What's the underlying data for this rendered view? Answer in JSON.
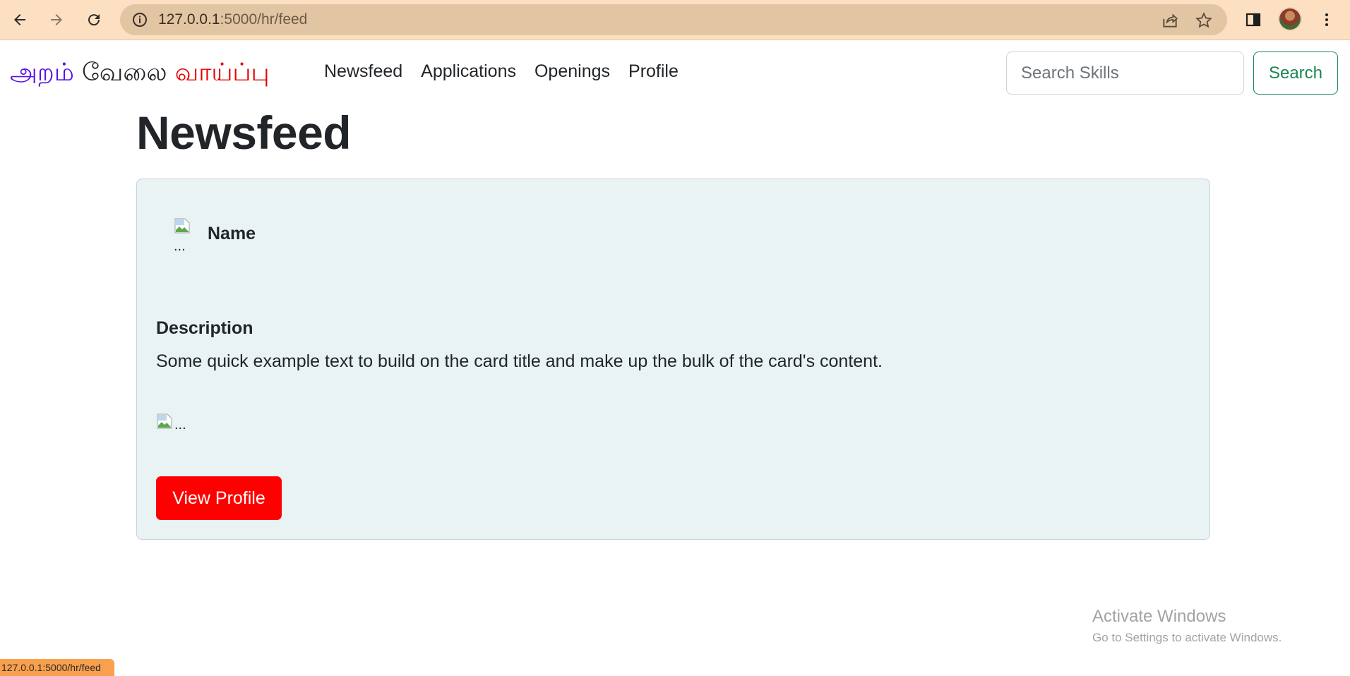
{
  "browser": {
    "url_host": "127.0.0.1",
    "url_path": ":5000/hr/feed",
    "status_url": "127.0.0.1:5000/hr/feed"
  },
  "navbar": {
    "brand_part1": "அறம்",
    "brand_part2": "வேலை",
    "brand_part3": "வாய்ப்பு",
    "links": [
      "Newsfeed",
      "Applications",
      "Openings",
      "Profile"
    ],
    "search_placeholder": "Search Skills",
    "search_button": "Search"
  },
  "page": {
    "title": "Newsfeed"
  },
  "post": {
    "author_alt": "...",
    "author_name": "Name",
    "description_title": "Description",
    "description_text": "Some quick example text to build on the card title and make up the bulk of the card's content.",
    "image_alt": "...",
    "view_profile_button": "View Profile"
  },
  "watermark": {
    "line1": "Activate Windows",
    "line2": "Go to Settings to activate Windows."
  },
  "colors": {
    "brand_purple": "#5a12e8",
    "brand_red": "#e60000",
    "search_green": "#198754",
    "view_profile_red": "#ff0000",
    "card_background": "#eaf3f4",
    "browser_chrome": "#fde0c2"
  }
}
